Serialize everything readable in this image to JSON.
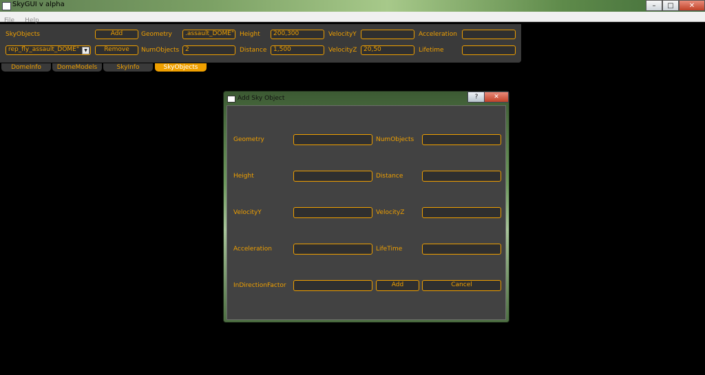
{
  "window": {
    "title": "SkyGUI v alpha",
    "minimize": "–",
    "maximize": "□",
    "close": "✕"
  },
  "menu": [
    "File",
    "Help"
  ],
  "toolbar": {
    "skyobjects_label": "SkyObjects",
    "add_button": "Add",
    "remove_button": "Remove",
    "combo_value": "rep_fly_assault_DOME\"",
    "geometry_label": "Geometry",
    "geometry_value": ".assault_DOME\"",
    "numobjects_label": "NumObjects",
    "numobjects_value": "2",
    "height_label": "Height",
    "height_value": "200,300",
    "distance_label": "Distance",
    "distance_value": "1,500",
    "velocityy_label": "VelocityY",
    "velocityy_value": "",
    "velocityz_label": "VelocityZ",
    "velocityz_value": "20,50",
    "acceleration_label": "Acceleration",
    "acceleration_value": "",
    "lifetime_label": "Lifetime",
    "lifetime_value": ""
  },
  "tabs": [
    "DomeInfo",
    "DomeModels",
    "SkyInfo",
    "SkyObjects"
  ],
  "dialog": {
    "title": "Add Sky Object",
    "help": "?",
    "close": "✕",
    "geometry_label": "Geometry",
    "numobjects_label": "NumObjects",
    "height_label": "Height",
    "distance_label": "Distance",
    "velocityy_label": "VelocityY",
    "velocityz_label": "VelocityZ",
    "acceleration_label": "Acceleration",
    "lifetime_label": "LifeTime",
    "indirectionfactor_label": "InDirectionFactor",
    "add_button": "Add",
    "cancel_button": "Cancel"
  },
  "colors": {
    "accent": "#f0a000",
    "panel": "#3a3a3a",
    "dialog_body": "#424242"
  }
}
